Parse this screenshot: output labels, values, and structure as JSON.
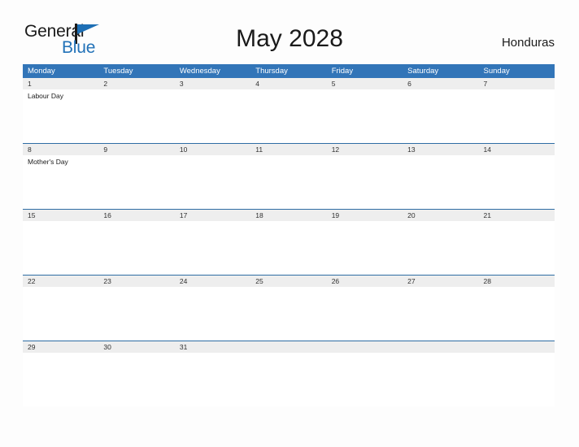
{
  "brand": {
    "name_part1": "General",
    "name_part2": "Blue",
    "logo_icon": "triangle-flag-icon",
    "accent_color": "#2272b8"
  },
  "header": {
    "title": "May 2028",
    "locale": "Honduras"
  },
  "calendar": {
    "month": "May",
    "year": "2028",
    "header_bg_color": "#3275b8",
    "date_strip_bg_color": "#eeeeee",
    "date_strip_border_color": "#2e6da4",
    "weekdays": [
      "Monday",
      "Tuesday",
      "Wednesday",
      "Thursday",
      "Friday",
      "Saturday",
      "Sunday"
    ],
    "weeks": [
      {
        "days": [
          {
            "num": "1",
            "events": [
              "Labour Day"
            ]
          },
          {
            "num": "2",
            "events": []
          },
          {
            "num": "3",
            "events": []
          },
          {
            "num": "4",
            "events": []
          },
          {
            "num": "5",
            "events": []
          },
          {
            "num": "6",
            "events": []
          },
          {
            "num": "7",
            "events": []
          }
        ]
      },
      {
        "days": [
          {
            "num": "8",
            "events": [
              "Mother's Day"
            ]
          },
          {
            "num": "9",
            "events": []
          },
          {
            "num": "10",
            "events": []
          },
          {
            "num": "11",
            "events": []
          },
          {
            "num": "12",
            "events": []
          },
          {
            "num": "13",
            "events": []
          },
          {
            "num": "14",
            "events": []
          }
        ]
      },
      {
        "days": [
          {
            "num": "15",
            "events": []
          },
          {
            "num": "16",
            "events": []
          },
          {
            "num": "17",
            "events": []
          },
          {
            "num": "18",
            "events": []
          },
          {
            "num": "19",
            "events": []
          },
          {
            "num": "20",
            "events": []
          },
          {
            "num": "21",
            "events": []
          }
        ]
      },
      {
        "days": [
          {
            "num": "22",
            "events": []
          },
          {
            "num": "23",
            "events": []
          },
          {
            "num": "24",
            "events": []
          },
          {
            "num": "25",
            "events": []
          },
          {
            "num": "26",
            "events": []
          },
          {
            "num": "27",
            "events": []
          },
          {
            "num": "28",
            "events": []
          }
        ]
      },
      {
        "days": [
          {
            "num": "29",
            "events": []
          },
          {
            "num": "30",
            "events": []
          },
          {
            "num": "31",
            "events": []
          },
          {
            "num": "",
            "events": []
          },
          {
            "num": "",
            "events": []
          },
          {
            "num": "",
            "events": []
          },
          {
            "num": "",
            "events": []
          }
        ]
      }
    ]
  }
}
